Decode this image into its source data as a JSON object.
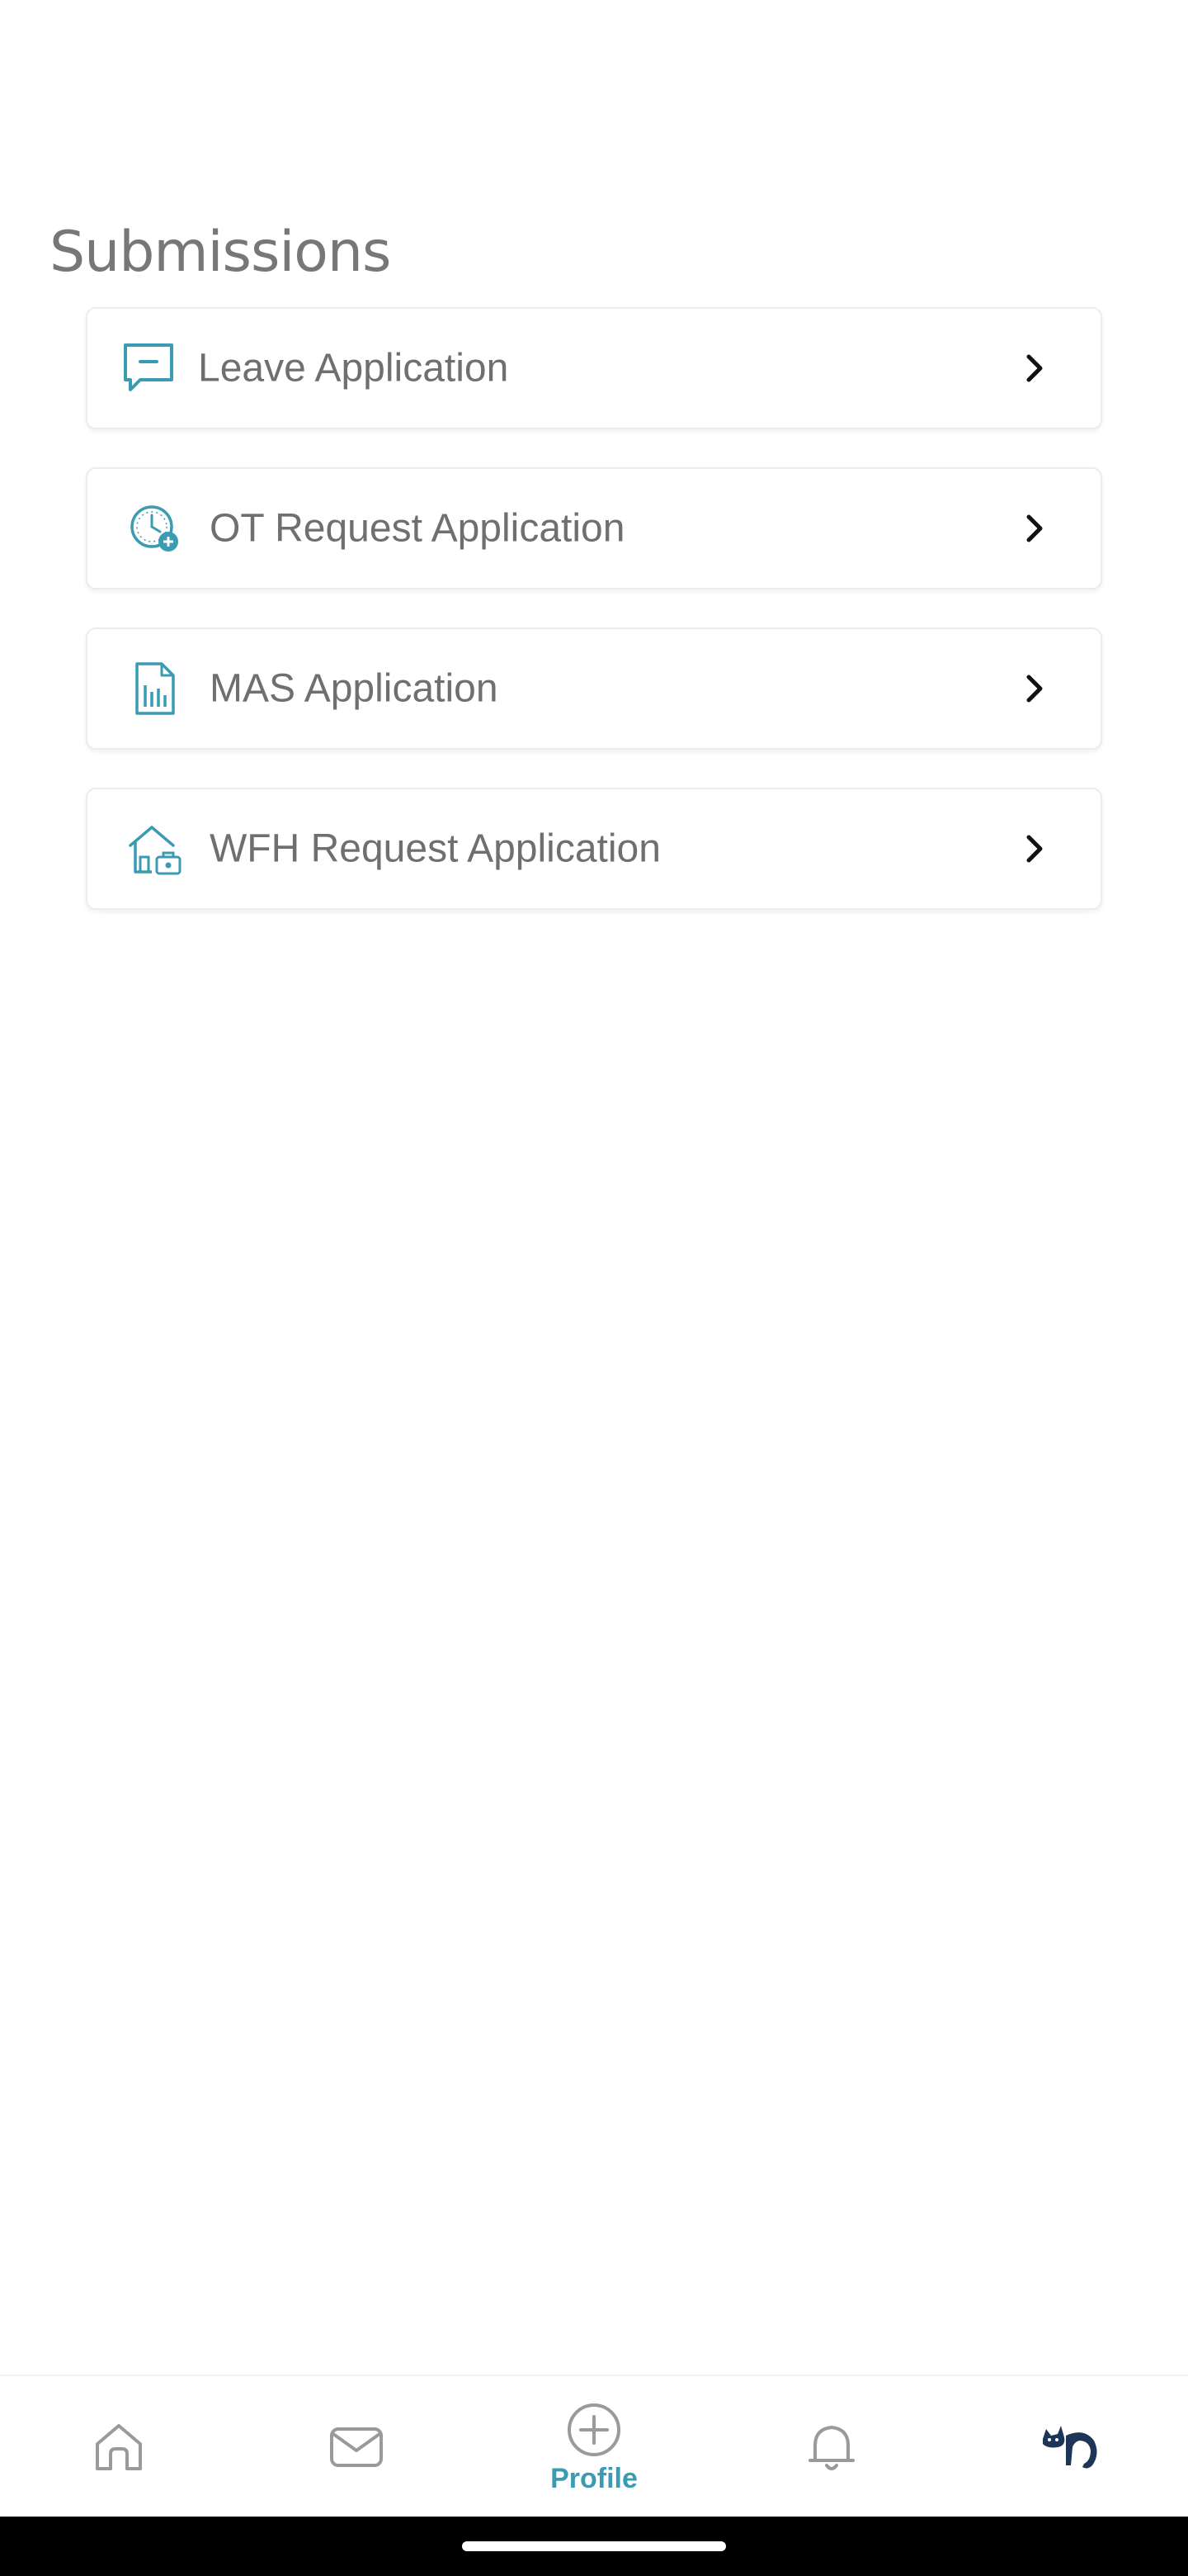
{
  "header": {
    "title": "Submissions"
  },
  "submissions": [
    {
      "label": "Leave Application",
      "icon": "chat-message-icon"
    },
    {
      "label": "OT Request Application",
      "icon": "clock-add-icon"
    },
    {
      "label": "MAS Application",
      "icon": "report-document-icon"
    },
    {
      "label": "WFH Request Application",
      "icon": "home-work-icon"
    }
  ],
  "bottom_nav": {
    "items": [
      {
        "icon": "home-icon"
      },
      {
        "icon": "mail-icon"
      },
      {
        "icon": "add-circle-icon",
        "label": "Profile",
        "active": true
      },
      {
        "icon": "bell-icon"
      },
      {
        "icon": "cat-avatar-icon"
      }
    ]
  },
  "colors": {
    "accent": "#3a9bb3",
    "text": "#6f6f6f",
    "title": "#777777",
    "nav_inactive": "#9a9a9a",
    "avatar": "#1d3557"
  }
}
